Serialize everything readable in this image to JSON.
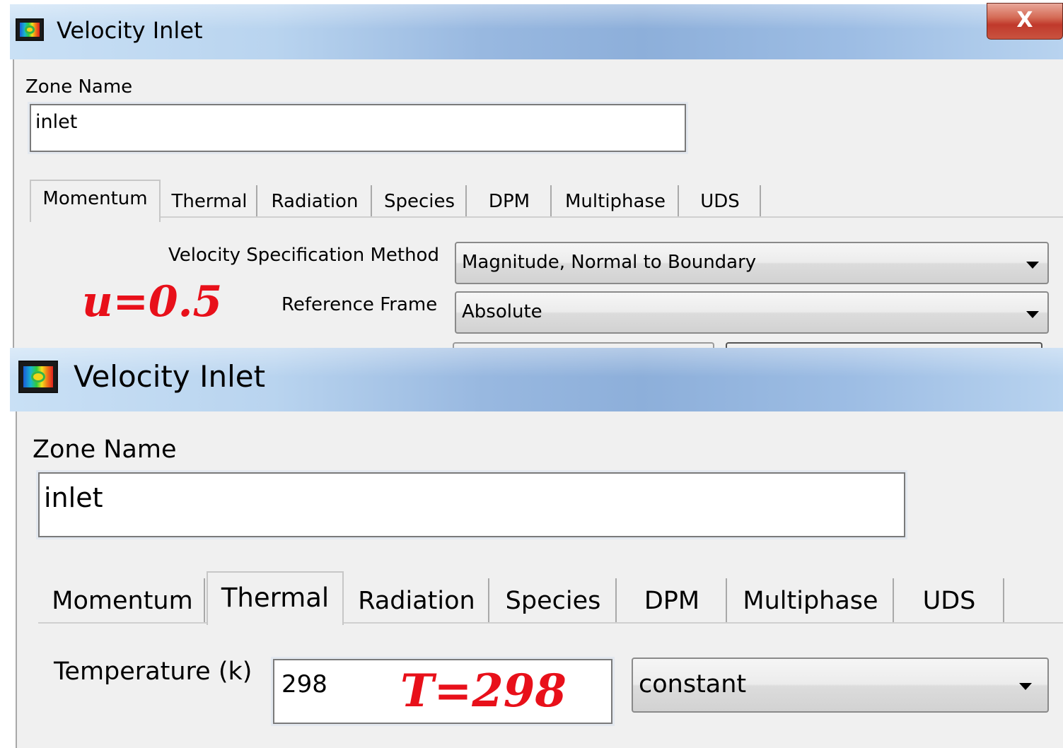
{
  "top_dialog": {
    "title": "Velocity Inlet",
    "close_label": "X",
    "zone_name_label": "Zone Name",
    "zone_name_value": "inlet",
    "tabs": [
      "Momentum",
      "Thermal",
      "Radiation",
      "Species",
      "DPM",
      "Multiphase",
      "UDS"
    ],
    "active_tab": "Momentum",
    "velocity_spec_label": "Velocity Specification Method",
    "velocity_spec_value": "Magnitude, Normal to Boundary",
    "reference_frame_label": "Reference Frame",
    "reference_frame_value": "Absolute",
    "annotation": "u=0.5"
  },
  "bottom_dialog": {
    "title": "Velocity Inlet",
    "zone_name_label": "Zone Name",
    "zone_name_value": "inlet",
    "tabs": [
      "Momentum",
      "Thermal",
      "Radiation",
      "Species",
      "DPM",
      "Multiphase",
      "UDS"
    ],
    "active_tab": "Thermal",
    "temperature_label": "Temperature (k)",
    "temperature_value": "298",
    "temperature_method": "constant",
    "annotation": "T=298"
  },
  "colors": {
    "annotation": "#e8101a",
    "titlebar_start": "#c9e0f5",
    "titlebar_mid": "#8dafda",
    "panel_bg": "#f0f0f0"
  },
  "icons": [
    "app-icon",
    "close-icon",
    "dropdown-arrow-icon"
  ]
}
